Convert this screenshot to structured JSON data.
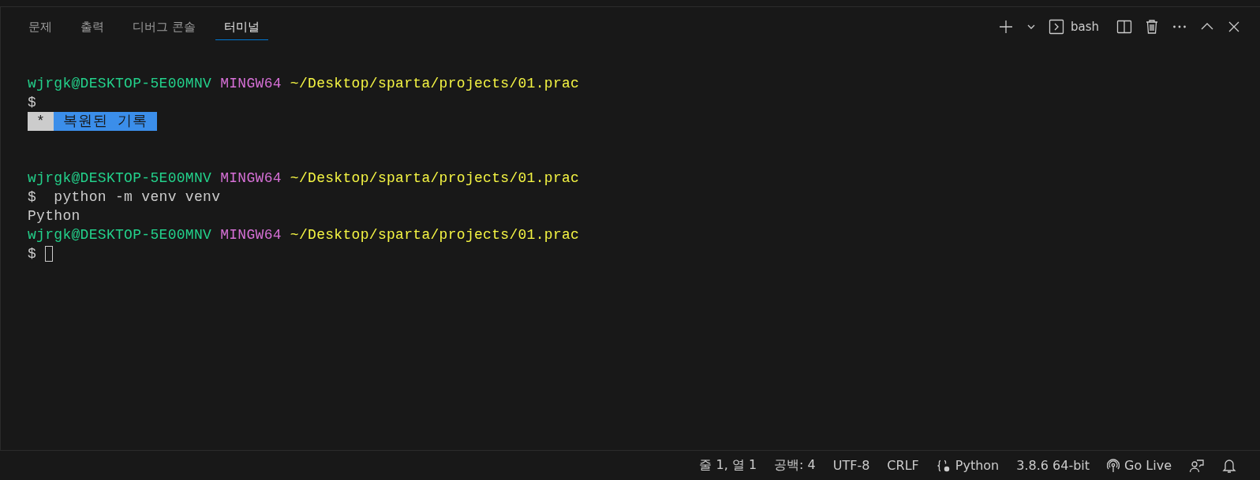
{
  "tabs": [
    {
      "label": "문제",
      "selected": false
    },
    {
      "label": "출력",
      "selected": false
    },
    {
      "label": "디버그 콘솔",
      "selected": false
    },
    {
      "label": "터미널",
      "selected": true
    }
  ],
  "toolbar": {
    "shell": "bash"
  },
  "terminal": {
    "lines": [
      [
        {
          "kind": "user",
          "text": "wjrgk@DESKTOP-5E00MNV"
        },
        {
          "kind": "host",
          "text": "MINGW64"
        },
        {
          "kind": "path",
          "text": "~/Desktop/sparta/projects/01.prac"
        }
      ],
      [
        {
          "kind": "plain",
          "text": "$"
        }
      ],
      [
        {
          "kind": "marker",
          "text": " * "
        },
        {
          "kind": "banner",
          "text": " 복원된 기록 "
        }
      ],
      [
        {
          "kind": "blank"
        }
      ],
      [
        {
          "kind": "blank"
        }
      ],
      [
        {
          "kind": "user",
          "text": "wjrgk@DESKTOP-5E00MNV"
        },
        {
          "kind": "host",
          "text": "MINGW64"
        },
        {
          "kind": "path",
          "text": "~/Desktop/sparta/projects/01.prac"
        }
      ],
      [
        {
          "kind": "plain",
          "text": "$  python -m venv venv"
        }
      ],
      [
        {
          "kind": "plain",
          "text": "Python"
        }
      ],
      [
        {
          "kind": "user",
          "text": "wjrgk@DESKTOP-5E00MNV"
        },
        {
          "kind": "host",
          "text": "MINGW64"
        },
        {
          "kind": "path",
          "text": "~/Desktop/sparta/projects/01.prac"
        }
      ],
      [
        {
          "kind": "plain",
          "text": "$"
        },
        {
          "kind": "cursor"
        }
      ]
    ]
  },
  "status_bar": [
    {
      "kind": "text",
      "text": "줄 1, 열 1"
    },
    {
      "kind": "text",
      "text": "공백: 4"
    },
    {
      "kind": "text",
      "text": "UTF-8"
    },
    {
      "kind": "text",
      "text": "CRLF"
    },
    {
      "kind": "language",
      "text": "Python"
    },
    {
      "kind": "text",
      "text": "3.8.6 64-bit"
    },
    {
      "kind": "live",
      "text": "Go Live"
    },
    {
      "kind": "feedback"
    },
    {
      "kind": "bell"
    }
  ]
}
